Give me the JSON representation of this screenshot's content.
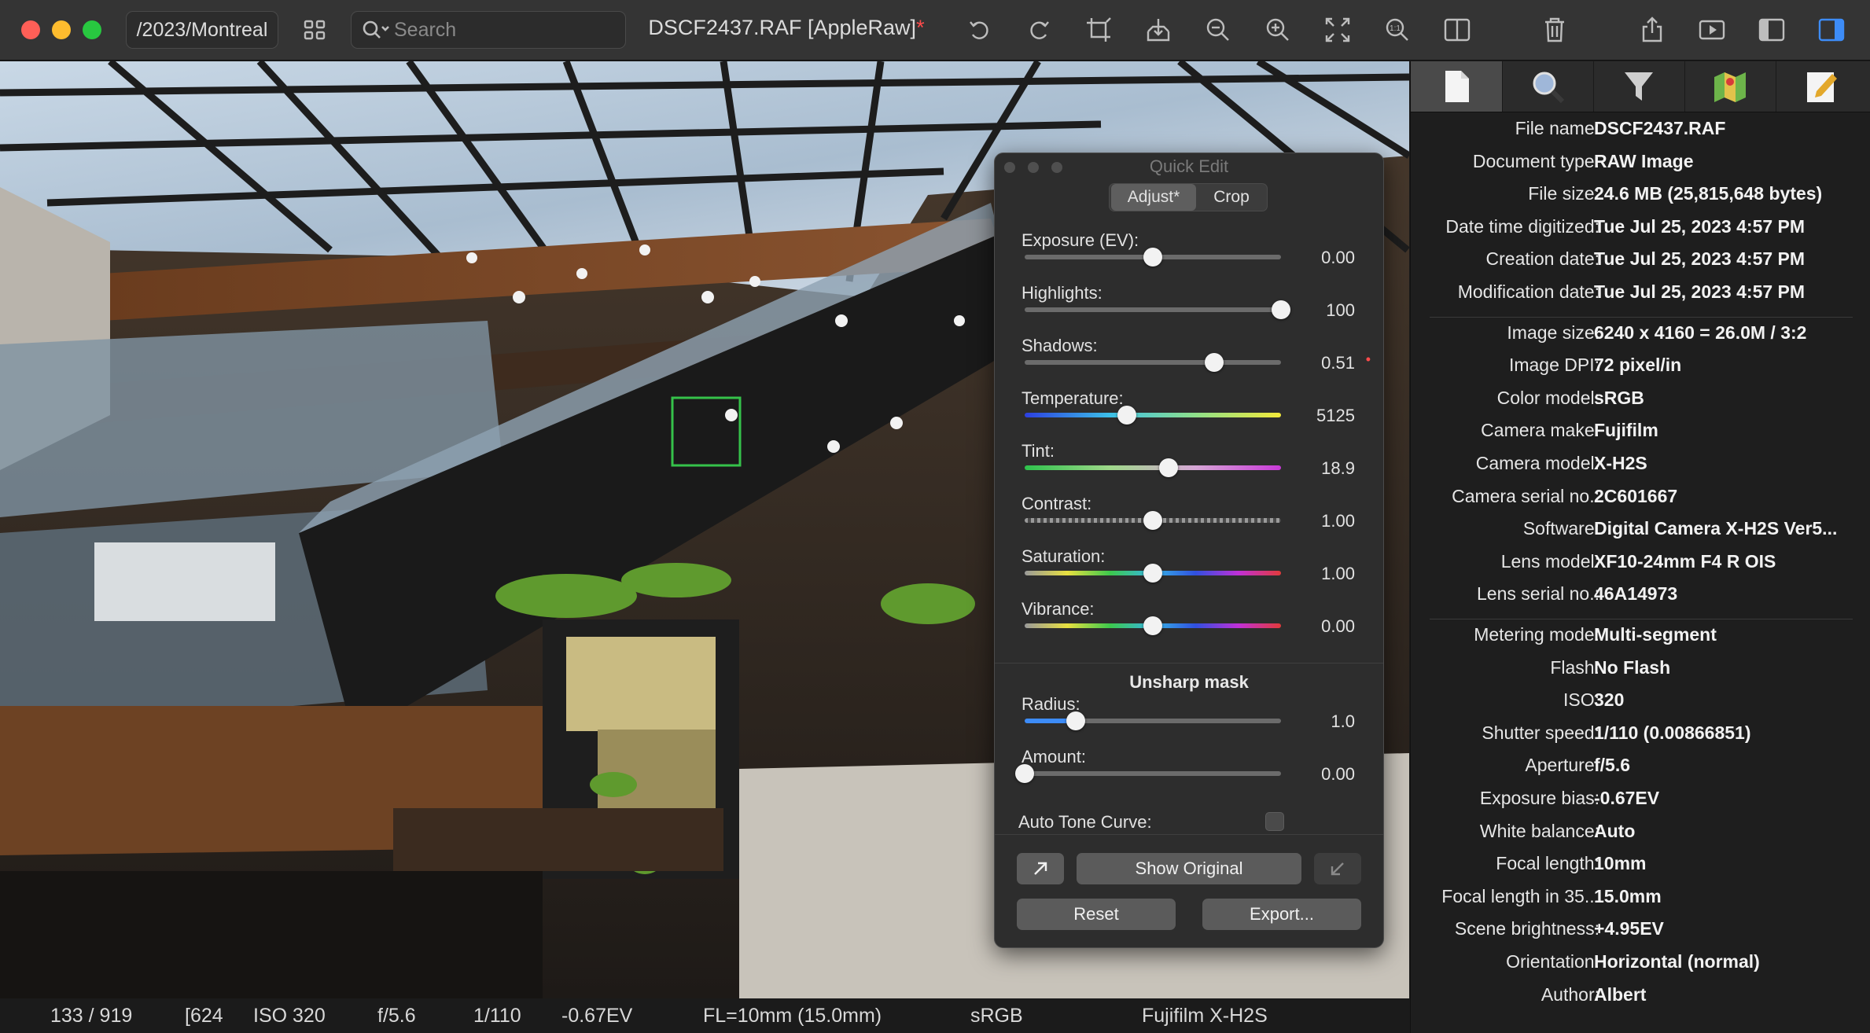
{
  "window": {
    "path": "/2023/Montreal",
    "title_file": "DSCF2437.RAF [AppleRaw]",
    "title_modified_mark": "*"
  },
  "search": {
    "placeholder": "Search"
  },
  "toolbar_icons": [
    "grid-icon",
    "search-icon",
    "rotate-left-icon",
    "rotate-right-icon",
    "crop-icon",
    "save-icon",
    "zoom-out-icon",
    "zoom-in-icon",
    "fit-icon",
    "actual-size-icon",
    "split-view-icon",
    "trash-icon",
    "share-icon",
    "slideshow-icon",
    "left-sidebar-icon",
    "right-sidebar-icon"
  ],
  "status_bar": {
    "index": "133 / 919",
    "dimensions": "[624",
    "iso": "ISO 320",
    "aperture": "f/5.6",
    "shutter": "1/110",
    "ev": "-0.67EV",
    "focal_length": "FL=10mm (15.0mm)",
    "color_space": "sRGB",
    "camera": "Fujifilm X-H2S"
  },
  "quick_edit": {
    "title": "Quick Edit",
    "tabs": [
      "Adjust*",
      "Crop"
    ],
    "sliders": [
      {
        "label": "Exposure (EV):",
        "value": "0.00",
        "position": 0.5,
        "track": "gray"
      },
      {
        "label": "Highlights:",
        "value": "100",
        "position": 1.0,
        "track": "gray"
      },
      {
        "label": "Shadows:",
        "value": "0.51",
        "position": 0.74,
        "track": "gray",
        "modified": true
      },
      {
        "label": "Temperature:",
        "value": "5125",
        "position": 0.4,
        "track": "temperature"
      },
      {
        "label": "Tint:",
        "value": "18.9",
        "position": 0.56,
        "track": "tint"
      },
      {
        "label": "Contrast:",
        "value": "1.00",
        "position": 0.5,
        "track": "checker"
      },
      {
        "label": "Saturation:",
        "value": "1.00",
        "position": 0.5,
        "track": "rainbow"
      },
      {
        "label": "Vibrance:",
        "value": "0.00",
        "position": 0.5,
        "track": "rainbow"
      }
    ],
    "section": "Unsharp mask",
    "unsharp": [
      {
        "label": "Radius:",
        "value": "1.0",
        "position": 0.2,
        "track": "blue"
      },
      {
        "label": "Amount:",
        "value": "0.00",
        "position": 0.0,
        "track": "gray"
      }
    ],
    "auto_tone_curve": "Auto Tone Curve:",
    "buttons": {
      "show_original": "Show Original",
      "reset": "Reset",
      "export": "Export..."
    }
  },
  "info_panel": {
    "tabs": [
      "file-icon",
      "magnifier-icon",
      "filter-icon",
      "map-icon",
      "pencil-icon"
    ],
    "groups": [
      [
        {
          "key": "File name:",
          "value": "DSCF2437.RAF"
        },
        {
          "key": "Document type:",
          "value": "RAW Image"
        },
        {
          "key": "File size:",
          "value": "24.6 MB (25,815,648 bytes)"
        },
        {
          "key": "Date time digitized:",
          "value": "Tue Jul 25, 2023  4:57 PM"
        },
        {
          "key": "Creation date:",
          "value": "Tue Jul 25, 2023  4:57 PM"
        },
        {
          "key": "Modification date:",
          "value": "Tue Jul 25, 2023  4:57 PM"
        }
      ],
      [
        {
          "key": "Image size:",
          "value": "6240 x 4160 = 26.0M / 3:2"
        },
        {
          "key": "Image DPI:",
          "value": "72 pixel/in"
        },
        {
          "key": "Color model:",
          "value": "sRGB"
        },
        {
          "key": "Camera make:",
          "value": "Fujifilm"
        },
        {
          "key": "Camera model:",
          "value": "X-H2S"
        },
        {
          "key": "Camera serial no.:",
          "value": "2C601667"
        },
        {
          "key": "Software:",
          "value": "Digital Camera X-H2S Ver5..."
        },
        {
          "key": "Lens model:",
          "value": "XF10-24mm F4 R OIS"
        },
        {
          "key": "Lens serial no.:",
          "value": "46A14973"
        }
      ],
      [
        {
          "key": "Metering mode:",
          "value": "Multi-segment"
        },
        {
          "key": "Flash:",
          "value": "No Flash"
        },
        {
          "key": "ISO:",
          "value": "320"
        },
        {
          "key": "Shutter speed:",
          "value": "1/110 (0.00866851)"
        },
        {
          "key": "Aperture:",
          "value": "f/5.6"
        },
        {
          "key": "Exposure bias:",
          "value": "-0.67EV"
        },
        {
          "key": "White balance:",
          "value": "Auto"
        },
        {
          "key": "Focal length:",
          "value": "10mm"
        },
        {
          "key": "Focal length in 35...",
          "value": "15.0mm"
        },
        {
          "key": "Scene brightness:",
          "value": "+4.95EV"
        },
        {
          "key": "Orientation:",
          "value": "Horizontal (normal)"
        },
        {
          "key": "Author:",
          "value": "Albert"
        }
      ]
    ]
  }
}
